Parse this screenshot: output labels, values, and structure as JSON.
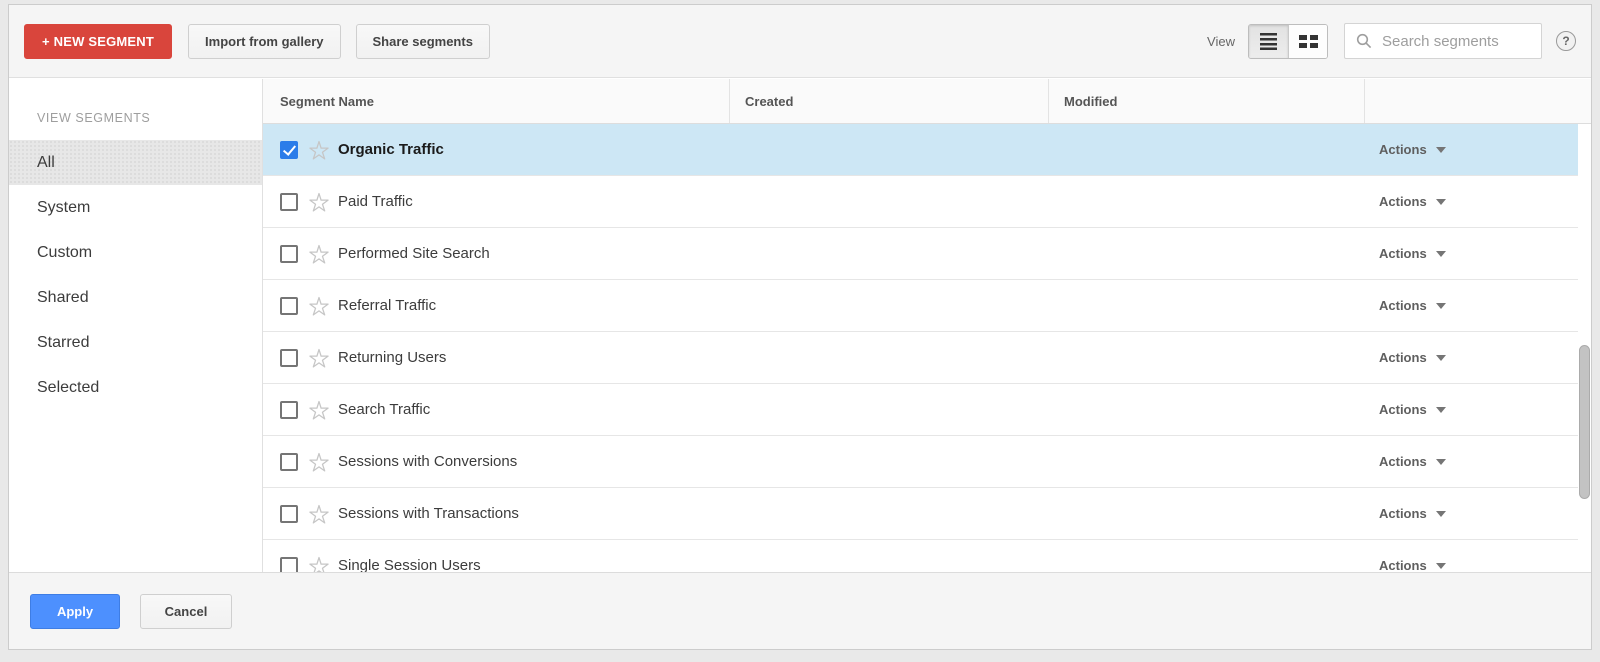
{
  "toolbar": {
    "new_segment_label": "+ NEW SEGMENT",
    "import_gallery_label": "Import from gallery",
    "share_segments_label": "Share segments",
    "view_label": "View",
    "search_placeholder": "Search segments",
    "help_label": "?"
  },
  "sidebar": {
    "heading": "VIEW SEGMENTS",
    "items": [
      {
        "label": "All",
        "selected": true
      },
      {
        "label": "System",
        "selected": false
      },
      {
        "label": "Custom",
        "selected": false
      },
      {
        "label": "Shared",
        "selected": false
      },
      {
        "label": "Starred",
        "selected": false
      },
      {
        "label": "Selected",
        "selected": false
      }
    ]
  },
  "table": {
    "columns": {
      "name": "Segment Name",
      "created": "Created",
      "modified": "Modified"
    },
    "actions_label": "Actions",
    "rows": [
      {
        "name": "Organic Traffic",
        "checked": true,
        "selected": true,
        "bold": true,
        "created": "",
        "modified": ""
      },
      {
        "name": "Paid Traffic",
        "checked": false,
        "selected": false,
        "bold": false,
        "created": "",
        "modified": ""
      },
      {
        "name": "Performed Site Search",
        "checked": false,
        "selected": false,
        "bold": false,
        "created": "",
        "modified": ""
      },
      {
        "name": "Referral Traffic",
        "checked": false,
        "selected": false,
        "bold": false,
        "created": "",
        "modified": ""
      },
      {
        "name": "Returning Users",
        "checked": false,
        "selected": false,
        "bold": false,
        "created": "",
        "modified": ""
      },
      {
        "name": "Search Traffic",
        "checked": false,
        "selected": false,
        "bold": false,
        "created": "",
        "modified": ""
      },
      {
        "name": "Sessions with Conversions",
        "checked": false,
        "selected": false,
        "bold": false,
        "created": "",
        "modified": ""
      },
      {
        "name": "Sessions with Transactions",
        "checked": false,
        "selected": false,
        "bold": false,
        "created": "",
        "modified": ""
      },
      {
        "name": "Single Session Users",
        "checked": false,
        "selected": false,
        "bold": false,
        "created": "",
        "modified": ""
      }
    ]
  },
  "footer": {
    "apply_label": "Apply",
    "cancel_label": "Cancel"
  },
  "colors": {
    "accent_red": "#d9453c",
    "accent_blue": "#4d90fe",
    "selected_row_bg": "#cde7f5",
    "checkbox_blue": "#2b7de9"
  }
}
